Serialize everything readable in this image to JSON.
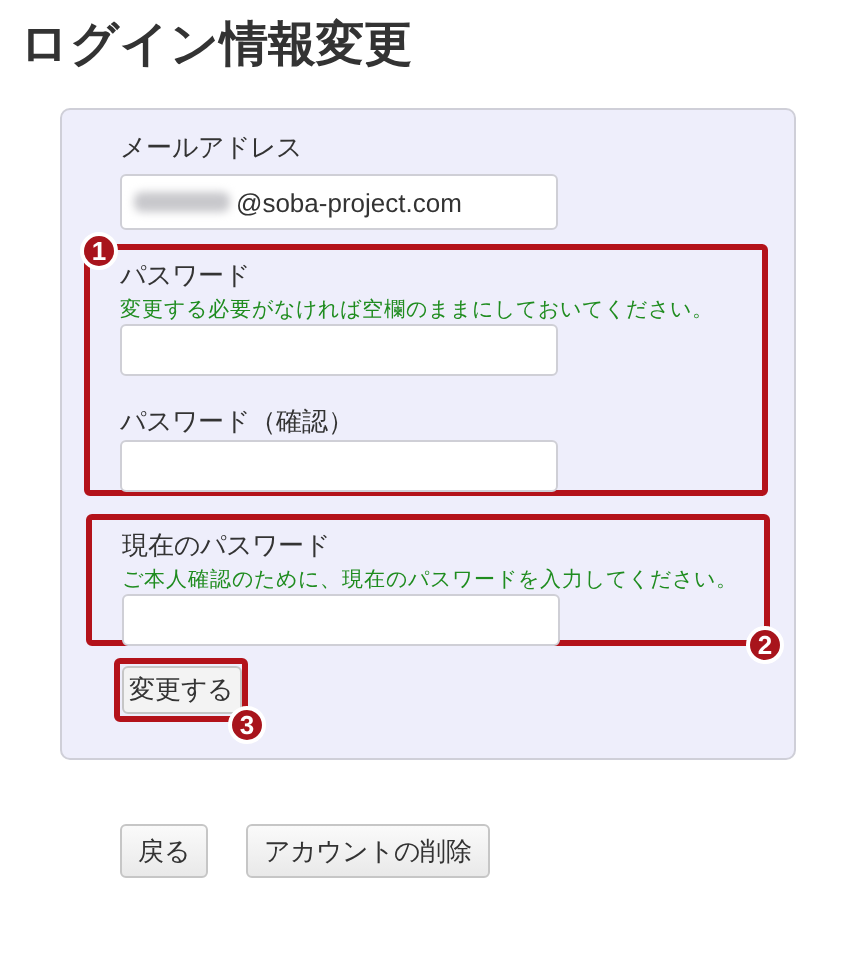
{
  "title": "ログイン情報変更",
  "email": {
    "label": "メールアドレス",
    "value": "@soba-project.com"
  },
  "groups": [
    {
      "badge": "1",
      "fields": [
        {
          "label": "パスワード",
          "hint": "変更する必要がなければ空欄のままにしておいてください。"
        },
        {
          "label": "パスワード（確認）"
        }
      ]
    },
    {
      "badge": "2",
      "fields": [
        {
          "label": "現在のパスワード",
          "hint": "ご本人確認のために、現在のパスワードを入力してください。"
        }
      ]
    }
  ],
  "submit": {
    "label": "変更する",
    "badge": "3"
  },
  "buttons": [
    "戻る",
    "アカウントの削除"
  ]
}
